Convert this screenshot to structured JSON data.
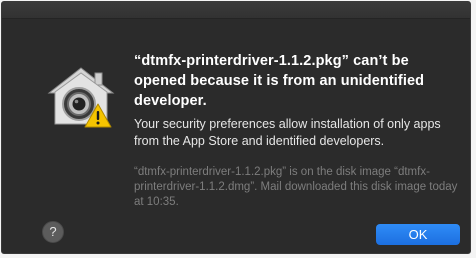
{
  "dialog": {
    "title": "“dtmfx-printerdriver-1.1.2.pkg” can’t be opened because it is from an unidentified developer.",
    "message": "Your security preferences allow installation of only apps from the App Store and identified developers.",
    "note": "“dtmfx-printerdriver-1.1.2.pkg” is on the disk image “dtmfx-printerdriver-1.1.2.dmg”. Mail downloaded this disk image today at 10:35.",
    "help_label": "?",
    "ok_label": "OK",
    "icon": "gatekeeper-warning-icon"
  },
  "colors": {
    "background": "#2b2b2b",
    "accent": "#1f78f0",
    "warning": "#f5c400"
  }
}
